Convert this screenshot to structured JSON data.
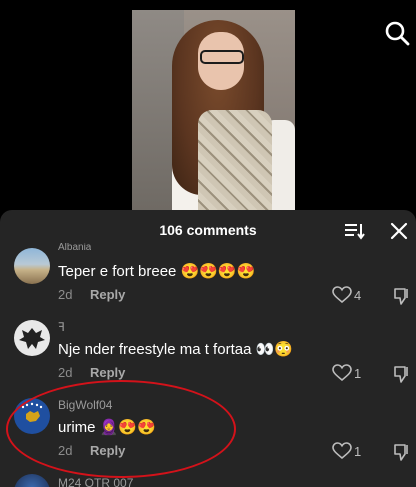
{
  "video": {
    "frame_colors": {
      "wall": "#7b716a",
      "hair": "#5b3520",
      "jacket": "#cfc6b4"
    }
  },
  "header": {
    "search_icon": "search-icon"
  },
  "comments_panel": {
    "title": "106 comments",
    "sort_icon": "sort-icon",
    "close_icon": "close-icon",
    "comments": [
      {
        "username": "Albania",
        "text": "Teper e fort breee",
        "emojis": "😍😍😍😍",
        "time": "2d",
        "reply_label": "Reply",
        "likes": "4",
        "avatar": "landscape-avatar"
      },
      {
        "username": "ꟻ",
        "text": "Nje nder freestyle ma t fortaa",
        "emojis": "👀😳",
        "time": "2d",
        "reply_label": "Reply",
        "likes": "1",
        "avatar": "eagle-avatar"
      },
      {
        "username": "BigWolf04",
        "text": "urime",
        "emojis": "🧕😍😍",
        "time": "2d",
        "reply_label": "Reply",
        "likes": "1",
        "avatar": "kosovo-flag-avatar"
      },
      {
        "username": "M24 OTR 007",
        "avatar": "globe-avatar"
      }
    ]
  },
  "colors": {
    "sheet_bg": "#252525",
    "highlight": "#d3121a"
  }
}
